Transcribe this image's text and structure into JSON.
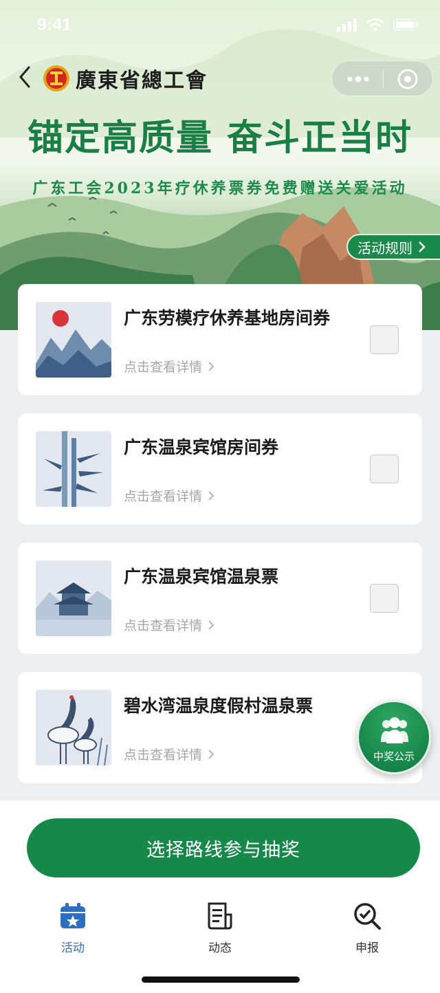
{
  "status_bar": {
    "time": "9:41"
  },
  "nav": {
    "logo_text": "廣東省總工會",
    "back_icon": "chevron-left-icon",
    "capsule_icons": [
      "more-dots-icon",
      "close-target-icon"
    ]
  },
  "banner": {
    "slogan": "锚定高质量  奋斗正当时",
    "subtitle": "广东工会2023年疗休养票券免费赠送关爱活动",
    "rules_button": "活动规则"
  },
  "items": [
    {
      "title": "广东劳模疗休养基地房间券",
      "link": "点击查看详情",
      "image": "mountains-sun-painting"
    },
    {
      "title": "广东温泉宾馆房间券",
      "link": "点击查看详情",
      "image": "bamboo-painting"
    },
    {
      "title": "广东温泉宾馆温泉票",
      "link": "点击查看详情",
      "image": "pavilion-painting"
    },
    {
      "title": "碧水湾温泉度假村温泉票",
      "link": "点击查看详情",
      "image": "cranes-painting"
    }
  ],
  "float_button": {
    "label": "中奖公示",
    "icon": "people-group-icon"
  },
  "cta": {
    "label": "选择路线参与抽奖"
  },
  "tabs": [
    {
      "label": "活动",
      "icon": "calendar-star-icon",
      "active": true
    },
    {
      "label": "动态",
      "icon": "document-icon",
      "active": false
    },
    {
      "label": "申报",
      "icon": "search-check-icon",
      "active": false
    }
  ],
  "colors": {
    "brand_green": "#16894a",
    "tab_active": "#2c6fbe"
  }
}
